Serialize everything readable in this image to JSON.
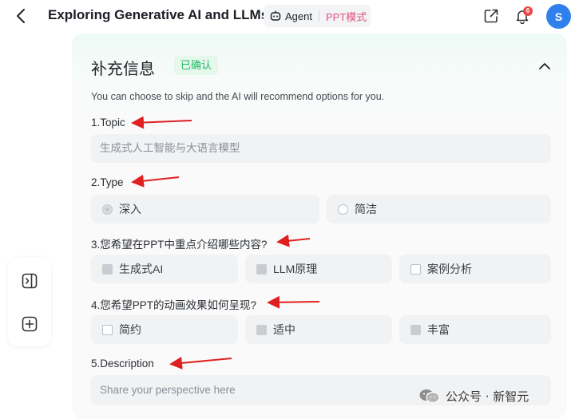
{
  "header": {
    "title": "Exploring Generative AI and LLMs",
    "agent_label": "Agent",
    "ppt_label": "PPT模式",
    "notification_count": "6",
    "avatar_initial": "S"
  },
  "panel": {
    "title": "补充信息",
    "status": "已确认",
    "hint": "You can choose to skip and the AI will recommend options for you.",
    "q1": {
      "label": "1.Topic",
      "value": "生成式人工智能与大语言模型"
    },
    "q2": {
      "label": "2.Type",
      "options": [
        {
          "label": "深入",
          "selected": true
        },
        {
          "label": "简洁",
          "selected": false
        }
      ]
    },
    "q3": {
      "label": "3.您希望在PPT中重点介绍哪些内容?",
      "options": [
        {
          "label": "生成式AI",
          "checked": true
        },
        {
          "label": "LLM原理",
          "checked": true
        },
        {
          "label": "案例分析",
          "checked": false
        }
      ]
    },
    "q4": {
      "label": "4.您希望PPT的动画效果如何呈现?",
      "options": [
        {
          "label": "简约",
          "checked": false
        },
        {
          "label": "适中",
          "checked": true
        },
        {
          "label": "丰富",
          "checked": true
        }
      ]
    },
    "q5": {
      "label": "5.Description",
      "placeholder": "Share your perspective here"
    }
  },
  "watermark": {
    "text": "公众号 · 新智元"
  },
  "colors": {
    "accent_green": "#22b868",
    "ppt_pink": "#e2507e",
    "avatar_blue": "#2f80ed",
    "annotation_red": "#e02020"
  },
  "icons": [
    "back-arrow-icon",
    "agent-robot-icon",
    "share-icon",
    "bell-icon",
    "chevron-up-icon",
    "sidebar-toggle-icon",
    "plus-square-icon",
    "wechat-icon"
  ]
}
